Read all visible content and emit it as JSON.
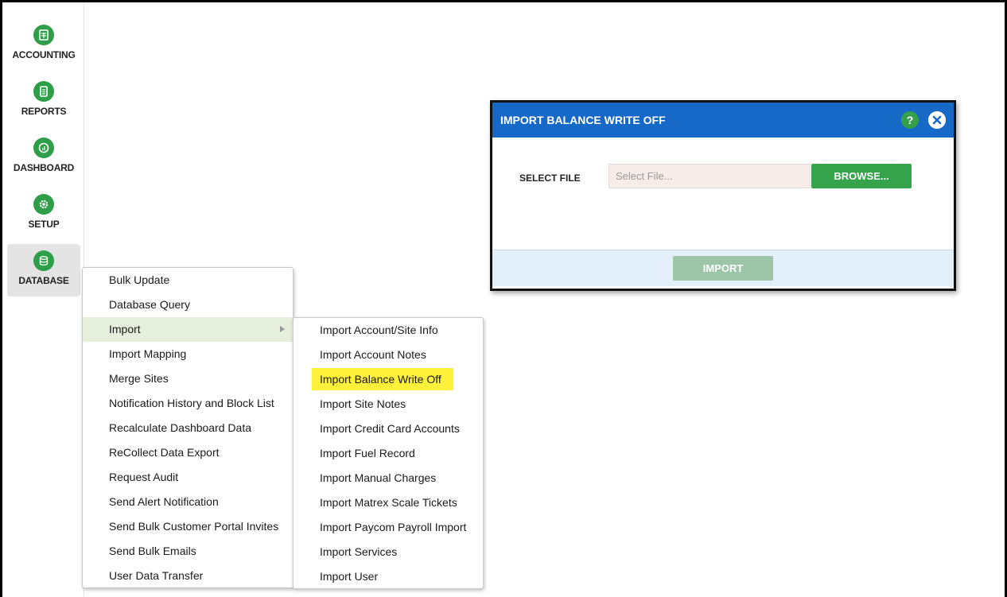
{
  "sidebar": {
    "items": [
      {
        "label": "ACCOUNTING",
        "icon": "calculator-icon"
      },
      {
        "label": "REPORTS",
        "icon": "document-icon"
      },
      {
        "label": "DASHBOARD",
        "icon": "gauge-icon"
      },
      {
        "label": "SETUP",
        "icon": "gear-icon"
      },
      {
        "label": "DATABASE",
        "icon": "database-icon"
      }
    ],
    "active": "DATABASE"
  },
  "database_menu": {
    "items": [
      "Bulk Update",
      "Database Query",
      "Import",
      "Import Mapping",
      "Merge Sites",
      "Notification History and Block List",
      "Recalculate Dashboard Data",
      "ReCollect Data Export",
      "Request Audit",
      "Send Alert Notification",
      "Send Bulk Customer Portal Invites",
      "Send Bulk Emails",
      "User Data Transfer"
    ],
    "open_item": "Import"
  },
  "import_menu": {
    "items": [
      "Import Account/Site Info",
      "Import Account Notes",
      "Import Balance Write Off",
      "Import Site Notes",
      "Import Credit Card Accounts",
      "Import Fuel Record",
      "Import Manual Charges",
      "Import Matrex Scale Tickets",
      "Import Paycom Payroll Import",
      "Import Services",
      "Import User"
    ],
    "highlighted_item": "Import Balance Write Off"
  },
  "dialog": {
    "title": "IMPORT BALANCE WRITE OFF",
    "help_symbol": "?",
    "select_file_label": "SELECT FILE",
    "file_placeholder": "Select File...",
    "browse_label": "BROWSE...",
    "import_label": "IMPORT"
  },
  "colors": {
    "brand_green": "#2e9e48",
    "header_blue": "#1769c7",
    "highlight_yellow": "#fff13a",
    "import_disabled": "#9dc6a8"
  }
}
